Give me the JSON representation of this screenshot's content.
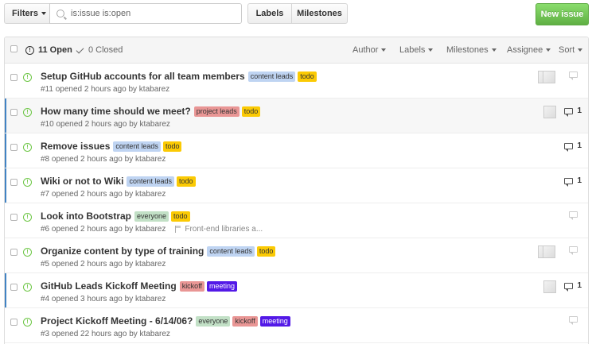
{
  "toolbar": {
    "filters_label": "Filters",
    "search_value": "is:issue is:open",
    "labels_label": "Labels",
    "milestones_label": "Milestones",
    "new_issue_label": "New issue"
  },
  "list_header": {
    "open_count": "11 Open",
    "closed_count": "0 Closed",
    "filters": [
      "Author",
      "Labels",
      "Milestones",
      "Assignee",
      "Sort"
    ]
  },
  "label_colors": {
    "content leads": {
      "bg": "#bfd4f2",
      "fg": "#333333"
    },
    "todo": {
      "bg": "#fbca04",
      "fg": "#333333"
    },
    "project leads": {
      "bg": "#e99695",
      "fg": "#333333"
    },
    "everyone": {
      "bg": "#c2e0c6",
      "fg": "#333333"
    },
    "kickoff": {
      "bg": "#e99695",
      "fg": "#333333"
    },
    "meeting": {
      "bg": "#5319e7",
      "fg": "#ffffff"
    }
  },
  "issues": [
    {
      "title": "Setup GitHub accounts for all team members",
      "labels": [
        "content leads",
        "todo"
      ],
      "meta": "#11 opened 2 hours ago by ktabarez",
      "milestone": "",
      "comments": "",
      "avatars": 2
    },
    {
      "title": "How many time should we meet?",
      "labels": [
        "project leads",
        "todo"
      ],
      "meta": "#10 opened 2 hours ago by ktabarez",
      "milestone": "",
      "comments": "1",
      "avatars": 1
    },
    {
      "title": "Remove issues",
      "labels": [
        "content leads",
        "todo"
      ],
      "meta": "#8 opened 2 hours ago by ktabarez",
      "milestone": "",
      "comments": "1",
      "avatars": 0
    },
    {
      "title": "Wiki or not to Wiki",
      "labels": [
        "content leads",
        "todo"
      ],
      "meta": "#7 opened 2 hours ago by ktabarez",
      "milestone": "",
      "comments": "1",
      "avatars": 0
    },
    {
      "title": "Look into Bootstrap",
      "labels": [
        "everyone",
        "todo"
      ],
      "meta": "#6 opened 2 hours ago by ktabarez",
      "milestone": "Front-end libraries a...",
      "comments": "",
      "avatars": 0
    },
    {
      "title": "Organize content by type of training",
      "labels": [
        "content leads",
        "todo"
      ],
      "meta": "#5 opened 2 hours ago by ktabarez",
      "milestone": "",
      "comments": "",
      "avatars": 2
    },
    {
      "title": "GitHub Leads Kickoff Meeting",
      "labels": [
        "kickoff",
        "meeting"
      ],
      "meta": "#4 opened 3 hours ago by ktabarez",
      "milestone": "",
      "comments": "1",
      "avatars": 1
    },
    {
      "title": "Project Kickoff Meeting - 6/14/06?",
      "labels": [
        "everyone",
        "kickoff",
        "meeting"
      ],
      "meta": "#3 opened 22 hours ago by ktabarez",
      "milestone": "",
      "comments": "",
      "avatars": 0
    }
  ]
}
